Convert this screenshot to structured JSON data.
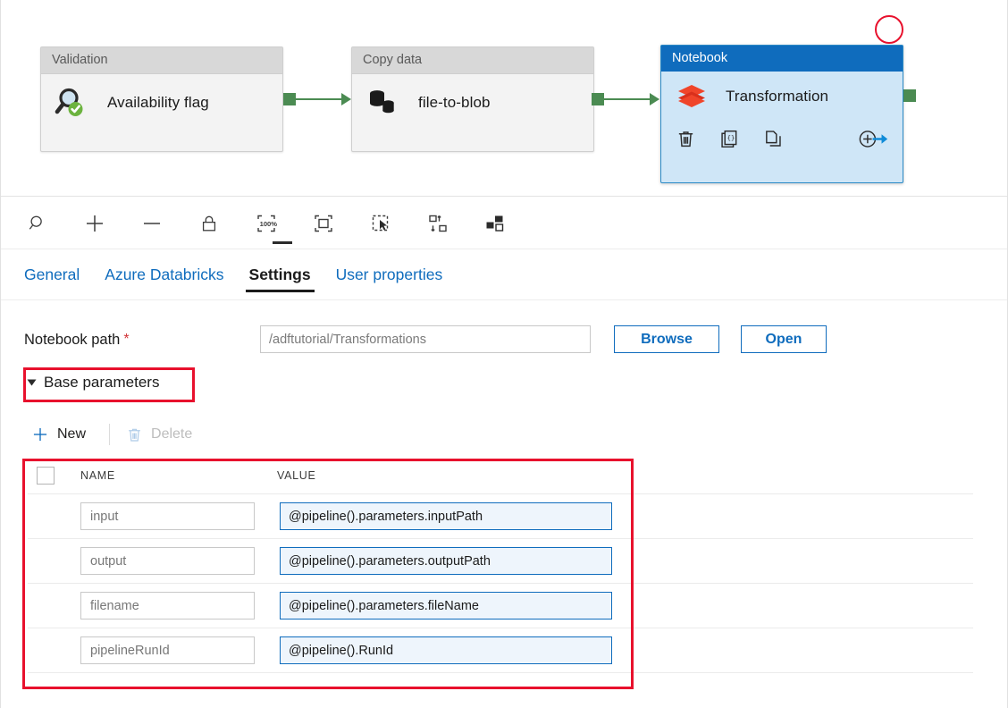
{
  "canvas": {
    "nodes": [
      {
        "type_label": "Validation",
        "name": "Availability flag",
        "icon": "magnifier-check-icon",
        "selected": false
      },
      {
        "type_label": "Copy data",
        "name": "file-to-blob",
        "icon": "database-copy-icon",
        "selected": false
      },
      {
        "type_label": "Notebook",
        "name": "Transformation",
        "icon": "databricks-icon",
        "selected": true
      }
    ],
    "selected_node_actions": [
      {
        "name": "delete-activity",
        "icon": "trash-icon"
      },
      {
        "name": "view-code",
        "icon": "code-braces-icon"
      },
      {
        "name": "clone-activity",
        "icon": "duplicate-icon"
      },
      {
        "name": "add-output-activity",
        "icon": "add-arrow-icon"
      }
    ],
    "accent_selected_header": "#0f6cbd",
    "accent_connector": "#4b8b52",
    "annotation_color": "#e8112d"
  },
  "toolbar": {
    "buttons": [
      {
        "name": "zoom-tool",
        "icon": "magnifier-icon",
        "title": "Zoom"
      },
      {
        "name": "zoom-in",
        "icon": "plus-icon",
        "title": "Zoom in"
      },
      {
        "name": "zoom-out",
        "icon": "minus-icon",
        "title": "Zoom out"
      },
      {
        "name": "lock-canvas",
        "icon": "lock-icon",
        "title": "Lock"
      },
      {
        "name": "zoom-100",
        "icon": "zoom-100-icon",
        "title": "100%"
      },
      {
        "name": "zoom-to-fit",
        "icon": "fit-to-screen-icon",
        "title": "Zoom to fit"
      },
      {
        "name": "marquee-select",
        "icon": "marquee-select-icon",
        "title": "Select"
      },
      {
        "name": "auto-align",
        "icon": "auto-align-icon",
        "title": "Auto align"
      },
      {
        "name": "layout-view",
        "icon": "layout-icon",
        "title": "Layout"
      }
    ],
    "zoom_label": "100%"
  },
  "tabs": [
    {
      "label": "General",
      "active": false
    },
    {
      "label": "Azure Databricks",
      "active": false
    },
    {
      "label": "Settings",
      "active": true
    },
    {
      "label": "User properties",
      "active": false
    }
  ],
  "settings": {
    "notebook_path": {
      "label": "Notebook path",
      "required_mark": "*",
      "value": "/adftutorial/Transformations",
      "placeholder": "/adftutorial/Transformations"
    },
    "browse_label": "Browse",
    "open_label": "Open",
    "base_parameters": {
      "section_title": "Base parameters",
      "expanded": true,
      "new_label": "New",
      "delete_label": "Delete",
      "delete_disabled": true,
      "columns": [
        "NAME",
        "VALUE"
      ],
      "rows": [
        {
          "name": "input",
          "value": "@pipeline().parameters.inputPath"
        },
        {
          "name": "output",
          "value": "@pipeline().parameters.outputPath"
        },
        {
          "name": "filename",
          "value": "@pipeline().parameters.fileName"
        },
        {
          "name": "pipelineRunId",
          "value": "@pipeline().RunId"
        }
      ]
    }
  }
}
